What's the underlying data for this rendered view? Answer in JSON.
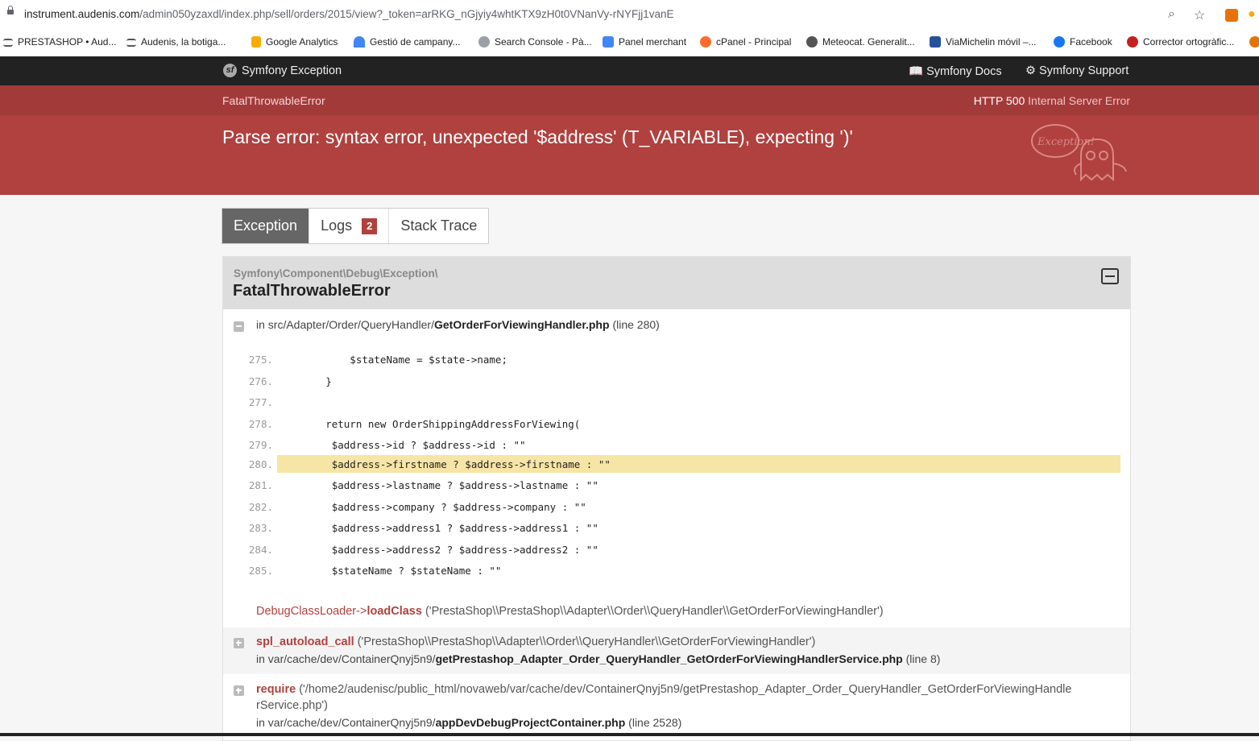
{
  "browser": {
    "url_host": "instrument.audenis.com",
    "url_path": "/admin050yzaxdl/index.php/sell/orders/2015/view?_token=arRKG_nGjyiy4whtKTX9zH0t0VNanVy-rNYFjj1vanE",
    "bookmarks": [
      "PRESTASHOP • Aud...",
      "Audenis, la botiga...",
      "Google Analytics",
      "Gestió de campany...",
      "Search Console - Pà...",
      "Panel merchant",
      "cPanel - Principal",
      "Meteocat. Generalit...",
      "ViaMichelin móvil –...",
      "Facebook",
      "Corrector ortogràfic..."
    ]
  },
  "symfony": {
    "title": "Symfony Exception",
    "docs": "Symfony Docs",
    "support": "Symfony Support",
    "exception_class": "FatalThrowableError",
    "http_code": "HTTP 500",
    "http_text": "Internal Server Error",
    "message": "Parse error: syntax error, unexpected '$address' (T_VARIABLE), expecting ')'",
    "ghost_text": "Exception!"
  },
  "tabs": [
    {
      "label": "Exception"
    },
    {
      "label": "Logs",
      "badge": "2"
    },
    {
      "label": "Stack Trace"
    }
  ],
  "exception": {
    "namespace": "Symfony\\Component\\Debug\\Exception\\",
    "class": "FatalThrowableError",
    "location_prefix": "in src/Adapter/Order/QueryHandler/",
    "location_file": "GetOrderForViewingHandler.php",
    "location_line": "(line 280)",
    "code_lines": [
      {
        "n": "275.",
        "code": "            $stateName = $state->name;"
      },
      {
        "n": "276.",
        "code": "        }"
      },
      {
        "n": "277.",
        "code": ""
      },
      {
        "n": "278.",
        "code": "        return new OrderShippingAddressForViewing("
      },
      {
        "n": "279.",
        "code": "         $address->id ? $address->id : \"\""
      },
      {
        "n": "280.",
        "code": "         $address->firstname ? $address->firstname : \"\""
      },
      {
        "n": "281.",
        "code": "         $address->lastname ? $address->lastname : \"\""
      },
      {
        "n": "282.",
        "code": "         $address->company ? $address->company : \"\""
      },
      {
        "n": "283.",
        "code": "         $address->address1 ? $address->address1 : \"\""
      },
      {
        "n": "284.",
        "code": "         $address->address2 ? $address->address2 : \"\""
      },
      {
        "n": "285.",
        "code": "         $stateName ? $stateName : \"\""
      }
    ],
    "trace": [
      {
        "cls": "DebugClassLoader->",
        "fn": "loadClass",
        "args": "('PrestaShop\\\\PrestaShop\\\\Adapter\\\\Order\\\\QueryHandler\\\\GetOrderForViewingHandler')"
      },
      {
        "fn": "spl_autoload_call",
        "args": "('PrestaShop\\\\PrestaShop\\\\Adapter\\\\Order\\\\QueryHandler\\\\GetOrderForViewingHandler')",
        "loc_prefix": "in var/cache/dev/ContainerQnyj5n9/",
        "loc_file": "getPrestashop_Adapter_Order_QueryHandler_GetOrderForViewingHandlerService.php",
        "loc_line": "(line 8)"
      },
      {
        "fn": "require",
        "args": "('/home2/audenisc/public_html/novaweb/var/cache/dev/ContainerQnyj5n9/getPrestashop_Adapter_Order_QueryHandler_GetOrderForViewingHandle",
        "args2": "rService.php')",
        "loc_prefix": "in var/cache/dev/ContainerQnyj5n9/",
        "loc_file": "appDevDebugProjectContainer.php",
        "loc_line": "(line 2528)"
      }
    ]
  }
}
